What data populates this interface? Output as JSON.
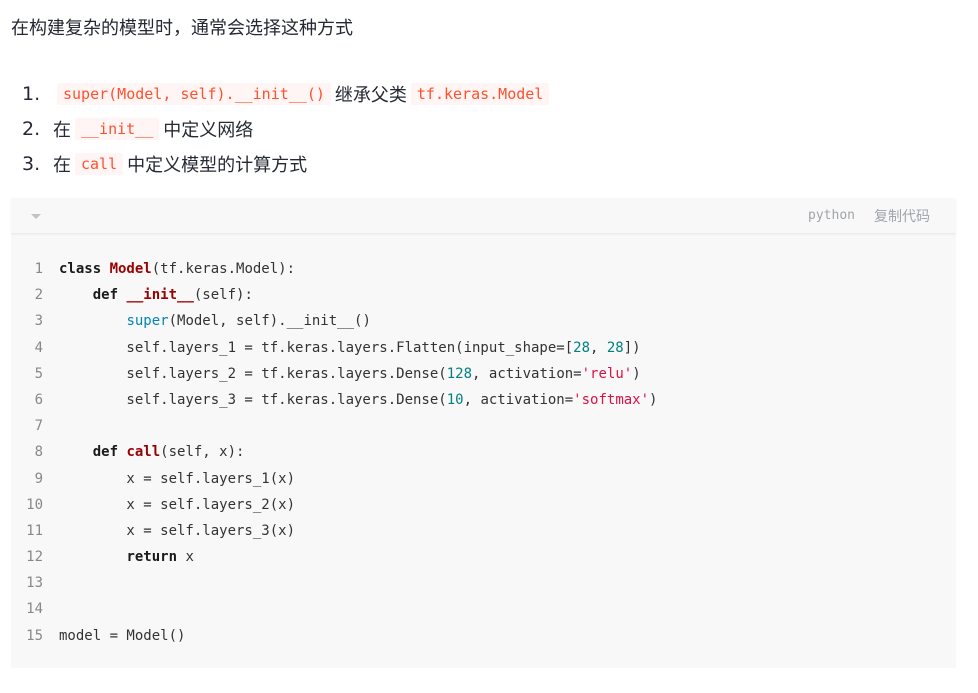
{
  "intro": "在构建复杂的模型时，通常会选择这种方式",
  "steps": [
    {
      "num": "1.",
      "code1": "super(Model, self).__init__()",
      "text": "继承父类",
      "code2": "tf.keras.Model"
    },
    {
      "num": "2.",
      "pre": "在",
      "code1": "__init__",
      "text": "中定义网络"
    },
    {
      "num": "3.",
      "pre": "在",
      "code1": "call",
      "text": "中定义模型的计算方式"
    }
  ],
  "code_block": {
    "language": "python",
    "copy_label": "复制代码",
    "lines": [
      {
        "no": "1",
        "tokens": [
          {
            "t": "class ",
            "c": "kw"
          },
          {
            "t": "Model",
            "c": "title"
          },
          {
            "t": "(tf.keras.Model):",
            "c": ""
          }
        ]
      },
      {
        "no": "2",
        "tokens": [
          {
            "t": "    ",
            "c": ""
          },
          {
            "t": "def ",
            "c": "kw"
          },
          {
            "t": "__init__",
            "c": "title"
          },
          {
            "t": "(self):",
            "c": ""
          }
        ]
      },
      {
        "no": "3",
        "tokens": [
          {
            "t": "        ",
            "c": ""
          },
          {
            "t": "super",
            "c": "builtin"
          },
          {
            "t": "(Model, self).__init__()",
            "c": ""
          }
        ]
      },
      {
        "no": "4",
        "tokens": [
          {
            "t": "        self.layers_1 = tf.keras.layers.Flatten(input_shape=[",
            "c": ""
          },
          {
            "t": "28",
            "c": "num"
          },
          {
            "t": ", ",
            "c": ""
          },
          {
            "t": "28",
            "c": "num"
          },
          {
            "t": "])",
            "c": ""
          }
        ]
      },
      {
        "no": "5",
        "tokens": [
          {
            "t": "        self.layers_2 = tf.keras.layers.Dense(",
            "c": ""
          },
          {
            "t": "128",
            "c": "num"
          },
          {
            "t": ", activation=",
            "c": ""
          },
          {
            "t": "'relu'",
            "c": "str"
          },
          {
            "t": ")",
            "c": ""
          }
        ]
      },
      {
        "no": "6",
        "tokens": [
          {
            "t": "        self.layers_3 = tf.keras.layers.Dense(",
            "c": ""
          },
          {
            "t": "10",
            "c": "num"
          },
          {
            "t": ", activation=",
            "c": ""
          },
          {
            "t": "'softmax'",
            "c": "str"
          },
          {
            "t": ")",
            "c": ""
          }
        ]
      },
      {
        "no": "7",
        "tokens": []
      },
      {
        "no": "8",
        "tokens": [
          {
            "t": "    ",
            "c": ""
          },
          {
            "t": "def ",
            "c": "kw"
          },
          {
            "t": "call",
            "c": "title"
          },
          {
            "t": "(self, x):",
            "c": ""
          }
        ]
      },
      {
        "no": "9",
        "tokens": [
          {
            "t": "        x = self.layers_1(x)",
            "c": ""
          }
        ]
      },
      {
        "no": "10",
        "tokens": [
          {
            "t": "        x = self.layers_2(x)",
            "c": ""
          }
        ]
      },
      {
        "no": "11",
        "tokens": [
          {
            "t": "        x = self.layers_3(x)",
            "c": ""
          }
        ]
      },
      {
        "no": "12",
        "tokens": [
          {
            "t": "        ",
            "c": ""
          },
          {
            "t": "return",
            "c": "kw"
          },
          {
            "t": " x",
            "c": ""
          }
        ]
      },
      {
        "no": "13",
        "tokens": []
      },
      {
        "no": "14",
        "tokens": []
      },
      {
        "no": "15",
        "tokens": [
          {
            "t": "model = Model()",
            "c": ""
          }
        ]
      }
    ]
  }
}
